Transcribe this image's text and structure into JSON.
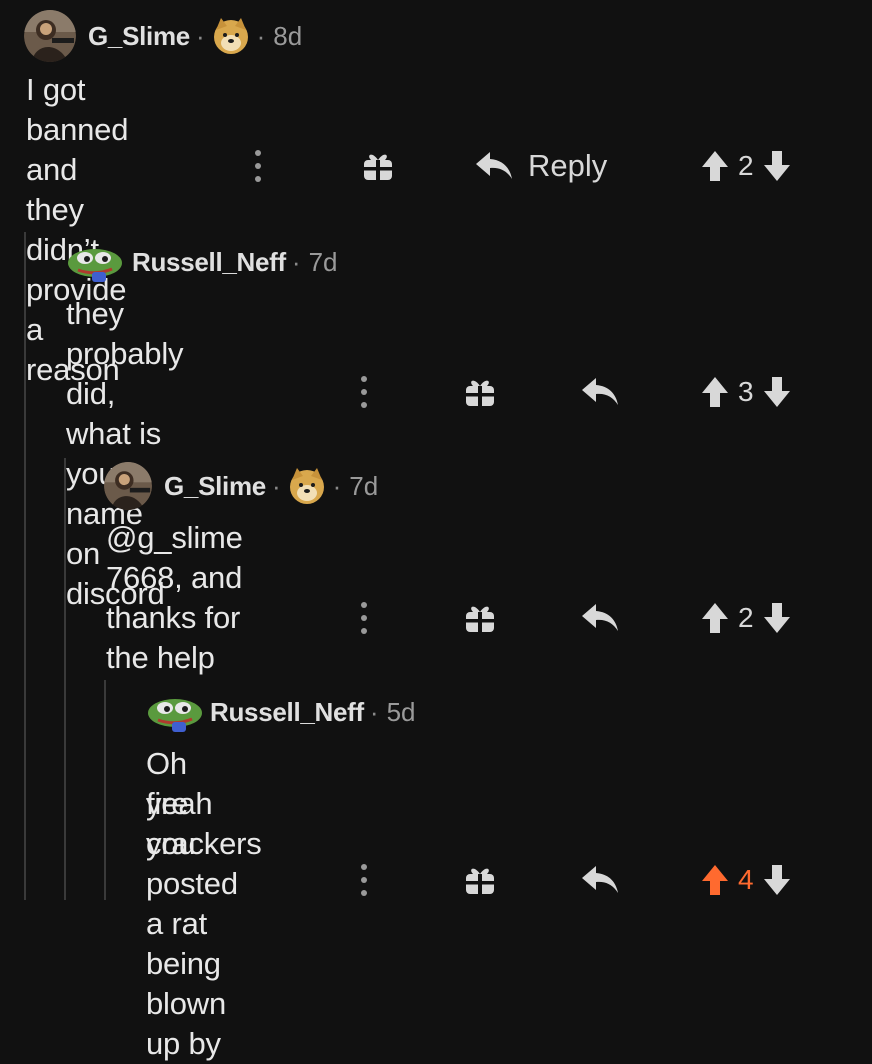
{
  "comments": [
    {
      "username": "G_Slime",
      "separator": "·",
      "age": "8d",
      "text": "I got banned and they didn’t provide a reason",
      "reply_label": "Reply",
      "votes": "2",
      "upvoted": false,
      "avatar": "user-avatar",
      "flair": "doge-flair"
    },
    {
      "username": "Russell_Neff",
      "separator": "·",
      "age": "7d",
      "text": "they probably did, what is your name on discord",
      "votes": "3",
      "upvoted": false,
      "avatar": "pepe-avatar"
    },
    {
      "username": "G_Slime",
      "separator": "·",
      "age": "7d",
      "text": "@g_slime 7668, and thanks for the help",
      "votes": "2",
      "upvoted": false,
      "avatar": "user-avatar",
      "flair": "doge-flair"
    },
    {
      "username": "Russell_Neff",
      "separator": "·",
      "age": "5d",
      "text_line1": "Oh yeah you posted a rat being blown up by",
      "text_line2": "fire crackers",
      "votes": "4",
      "upvoted": true,
      "avatar": "pepe-avatar"
    }
  ],
  "colors": {
    "background": "#111111",
    "upvote_active": "#ff6a2f",
    "icon": "#d8d8d8",
    "muted": "#9a9a9a"
  }
}
